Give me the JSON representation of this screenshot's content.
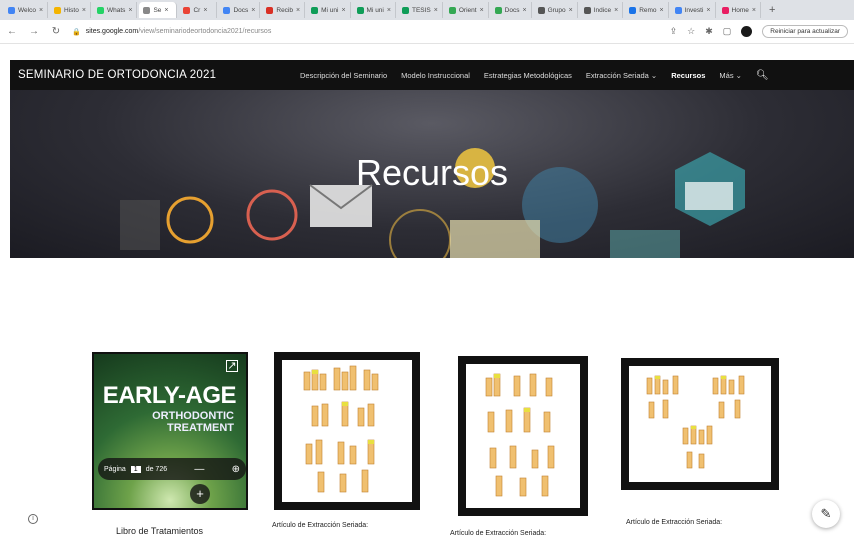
{
  "browser": {
    "tabs": [
      {
        "label": "Welco",
        "color": "#4285f4"
      },
      {
        "label": "Histo",
        "color": "#f4b400"
      },
      {
        "label": "Whats",
        "color": "#25d366"
      },
      {
        "label": "Se",
        "color": "#888888",
        "active": true
      },
      {
        "label": "Cr",
        "color": "#ea4335"
      },
      {
        "label": "Docs",
        "color": "#4285f4"
      },
      {
        "label": "Recib",
        "color": "#d93025"
      },
      {
        "label": "Mi uni",
        "color": "#0f9d58"
      },
      {
        "label": "Mi uni",
        "color": "#0f9d58"
      },
      {
        "label": "TESIS",
        "color": "#0f9d58"
      },
      {
        "label": "Orient",
        "color": "#34a853"
      },
      {
        "label": "Docs",
        "color": "#34a853"
      },
      {
        "label": "Grupo",
        "color": "#555555"
      },
      {
        "label": "Indice",
        "color": "#555555"
      },
      {
        "label": "Remo",
        "color": "#1a73e8"
      },
      {
        "label": "Investi",
        "color": "#4285f4"
      },
      {
        "label": "Home",
        "color": "#e91e63"
      }
    ],
    "url_host": "sites.google.com",
    "url_path": "/view/seminariodeortodoncia2021/recursos",
    "relaunch_label": "Reiniciar para actualizar"
  },
  "site": {
    "title": "SEMINARIO DE ORTODONCIA 2021",
    "nav": [
      {
        "label": "Descripción del Seminario"
      },
      {
        "label": "Modelo Instruccional"
      },
      {
        "label": "Estrategias Metodológicas"
      },
      {
        "label": "Extracción Seriada ⌄"
      },
      {
        "label": "Recursos",
        "current": true
      },
      {
        "label": "Más ⌄"
      }
    ]
  },
  "hero": {
    "title": "Recursos"
  },
  "book": {
    "title1": "EARLY-AGE",
    "title2": "ORTHODONTIC",
    "title3": "TREATMENT",
    "pager_label": "Página",
    "page": "1",
    "of_label": "de 726",
    "minus": "—",
    "plus": "+",
    "caption": "Libro de Tratamientos"
  },
  "cards": [
    {
      "caption": "Artículo de Extracción Seriada:"
    },
    {
      "caption": "Artículo de Extracción Seriada:"
    },
    {
      "caption": "Artículo de Extracción Seriada:"
    }
  ]
}
